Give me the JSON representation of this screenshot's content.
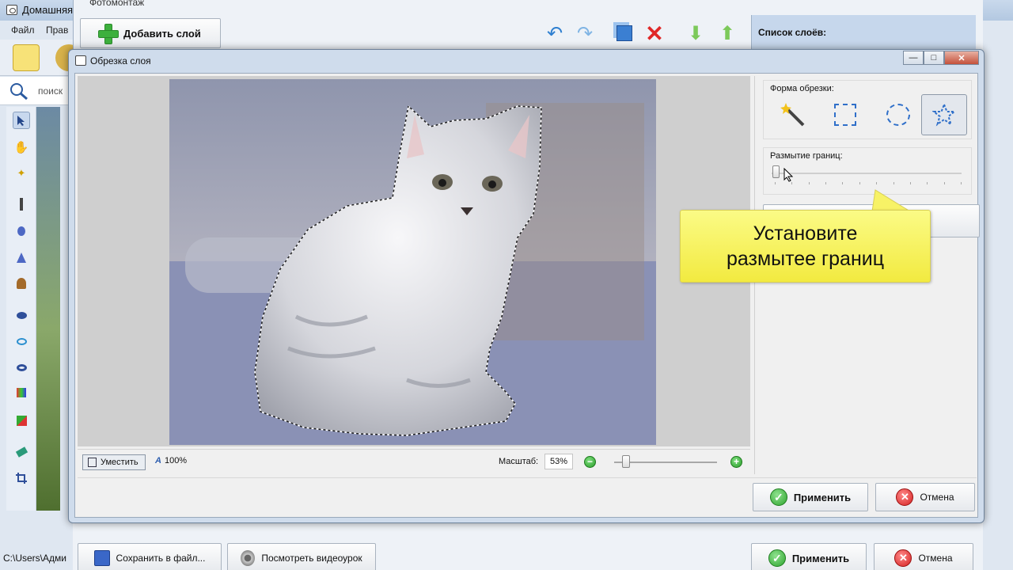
{
  "main_window": {
    "title": "Домашняя",
    "menu": [
      "Файл",
      "Прав"
    ],
    "search_placeholder": "поиск",
    "status_path": "C:\\Users\\Адми"
  },
  "fotomontage": {
    "title": "Фотомонтаж",
    "add_layer_label": "Добавить слой",
    "layers_title": "Список слоёв:",
    "save_label": "Сохранить в файл...",
    "video_label": "Посмотреть видеоурок",
    "apply_label": "Применить",
    "cancel_label": "Отмена"
  },
  "dialog": {
    "title": "Обрезка слоя",
    "fit_label": "Уместить",
    "percent_label": "100%",
    "scale_label": "Масштаб:",
    "scale_value": "53%",
    "zoom_level": 0.08,
    "shape_group_label": "Форма обрезки:",
    "shapes": [
      "magic-wand",
      "rectangle",
      "ellipse",
      "star"
    ],
    "selected_shape": "star",
    "blur_label": "Размытие границ:",
    "blur_value": 0,
    "apply_label": "Применить",
    "cancel_label": "Отмена"
  },
  "tooltip": {
    "text": "Установите\nразмытее границ"
  },
  "colors": {
    "accent_green": "#2ea42e",
    "cancel_red": "#d42020",
    "callout_yellow": "#f7f266",
    "selection_blue": "#2f6fc9"
  }
}
